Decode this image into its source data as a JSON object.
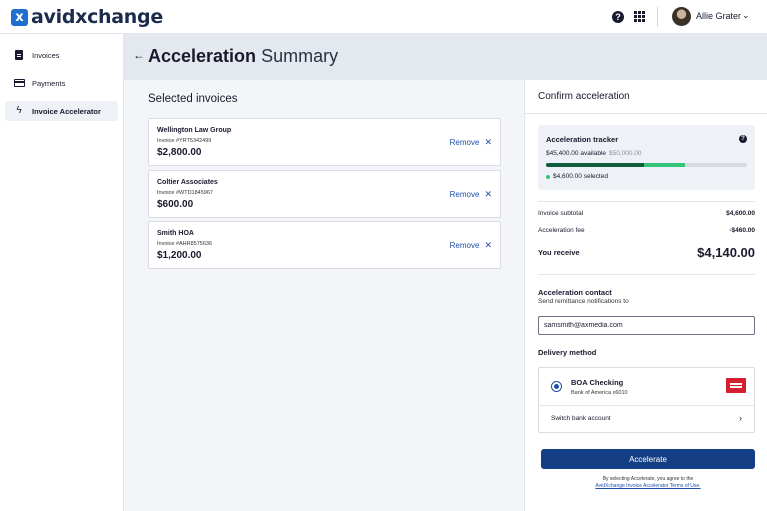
{
  "header": {
    "logo_mark": "x",
    "logo_text": "avidxchange",
    "help_icon": "help-circle-icon",
    "help_glyph": "?",
    "apps_icon": "grid-apps-icon",
    "user_name": "Allie Grater",
    "user_menu_icon": "chevron-down-icon",
    "user_chevron": "⌄"
  },
  "sidebar": {
    "items": [
      {
        "label": "Invoices",
        "icon": "document-icon",
        "active": false
      },
      {
        "label": "Payments",
        "icon": "credit-card-icon",
        "active": false
      },
      {
        "label": "Invoice Accelerator",
        "icon": "lightning-bolt-icon",
        "active": true
      }
    ]
  },
  "page": {
    "back_icon": "arrow-left-icon",
    "back_glyph": "←",
    "title_bold": "Acceleration",
    "title_light": "Summary"
  },
  "selected_invoices": {
    "title": "Selected invoices",
    "remove_label": "Remove",
    "remove_glyph": "✕",
    "items": [
      {
        "vendor": "Wellington Law Group",
        "invoice_number": "Invoice #YRT5342499",
        "amount": "$2,800.00"
      },
      {
        "vendor": "Coltier Associates",
        "invoice_number": "Invoice #WTD1845967",
        "amount": "$600.00"
      },
      {
        "vendor": "Smith HOA",
        "invoice_number": "Invoice #AHR8575636",
        "amount": "$1,200.00"
      }
    ]
  },
  "confirm": {
    "title": "Confirm acceleration",
    "tracker": {
      "title": "Acceleration tracker",
      "help_glyph": "?",
      "available": "$45,400.00 available",
      "total": "$50,000.00",
      "selected": "$4,600.00 selected",
      "available_value": 45400,
      "selected_value": 4600,
      "total_value": 50000,
      "colors": {
        "available": "#0f5c3e",
        "selected": "#37c27b"
      }
    },
    "summary": {
      "subtotal_label": "Invoice subtotal",
      "subtotal_value": "$4,600.00",
      "fee_label": "Acceleration fee",
      "fee_value": "-$460.00",
      "receive_label": "You receive",
      "receive_value": "$4,140.00"
    },
    "contact": {
      "title": "Acceleration contact",
      "subtitle": "Send remittance notifications to",
      "email": "samsmith@axmedia.com"
    },
    "delivery": {
      "title": "Delivery method",
      "bank_name": "BOA Checking",
      "bank_sub": "Bank of America  x6010",
      "bank_logo_icon": "bank-of-america-logo",
      "switch_label": "Switch bank account",
      "switch_glyph": "›"
    },
    "accelerate_label": "Accelerate",
    "terms_prefix": "By selecting Accelerate, you agree to the",
    "terms_link": "AvidXchange Invoice Accelerator Terms of Use."
  }
}
